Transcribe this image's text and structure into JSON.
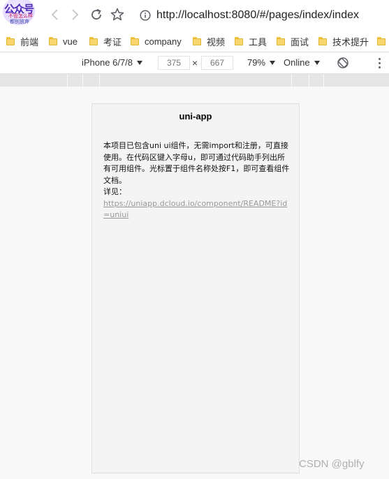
{
  "browser": {
    "logo_lines": [
      "公众号",
      "不管怎么样",
      "都别放弃"
    ],
    "url": "http://localhost:8080/#/pages/index/index"
  },
  "bookmarks": [
    {
      "label": "前端",
      "icon": "folder-icon"
    },
    {
      "label": "vue",
      "icon": "folder-icon"
    },
    {
      "label": "考证",
      "icon": "folder-icon"
    },
    {
      "label": "company",
      "icon": "folder-icon"
    },
    {
      "label": "视频",
      "icon": "folder-icon"
    },
    {
      "label": "工具",
      "icon": "folder-icon"
    },
    {
      "label": "面试",
      "icon": "folder-icon"
    },
    {
      "label": "技术提升",
      "icon": "folder-icon"
    }
  ],
  "device_toolbar": {
    "device": "iPhone 6/7/8",
    "width_placeholder": "375",
    "height_placeholder": "667",
    "dim_separator": "×",
    "zoom": "79%",
    "network": "Online"
  },
  "page": {
    "title": "uni-app",
    "description": "本项目已包含uni ui组件，无需import和注册，可直接使用。在代码区键入字母u，即可通过代码助手列出所有可用组件。光标置于组件名称处按F1，即可查看组件文档。",
    "detail_label": "详见：",
    "detail_link": "https://uniapp.dcloud.io/component/README?id=uniui"
  },
  "watermark": "CSDN @gblfy",
  "colors": {
    "folder": "#f8d66d",
    "link": "#999999",
    "phone_bg": "#f4f4f4"
  }
}
